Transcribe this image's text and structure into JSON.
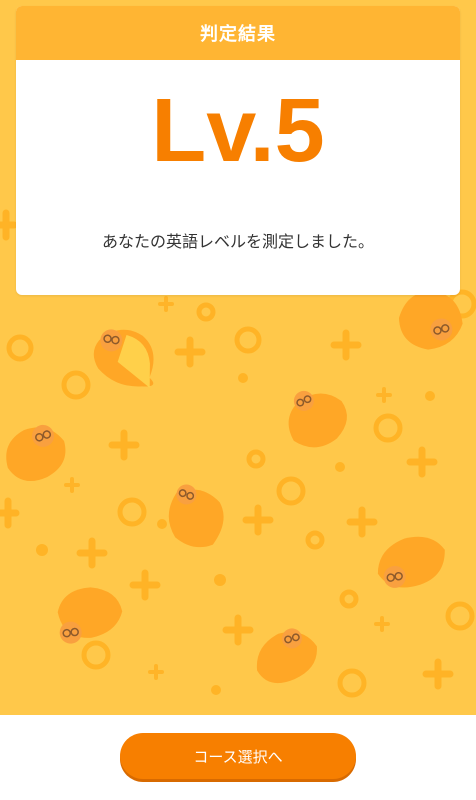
{
  "result_card": {
    "title": "判定結果",
    "level": "Lv.5",
    "message": "あなたの英語レベルを測定しました。"
  },
  "action": {
    "course_button_label": "コース選択へ"
  },
  "colors": {
    "background": "#ffc84a",
    "header": "#ffb533",
    "accent": "#f77f00",
    "pattern": "#ffb020"
  }
}
